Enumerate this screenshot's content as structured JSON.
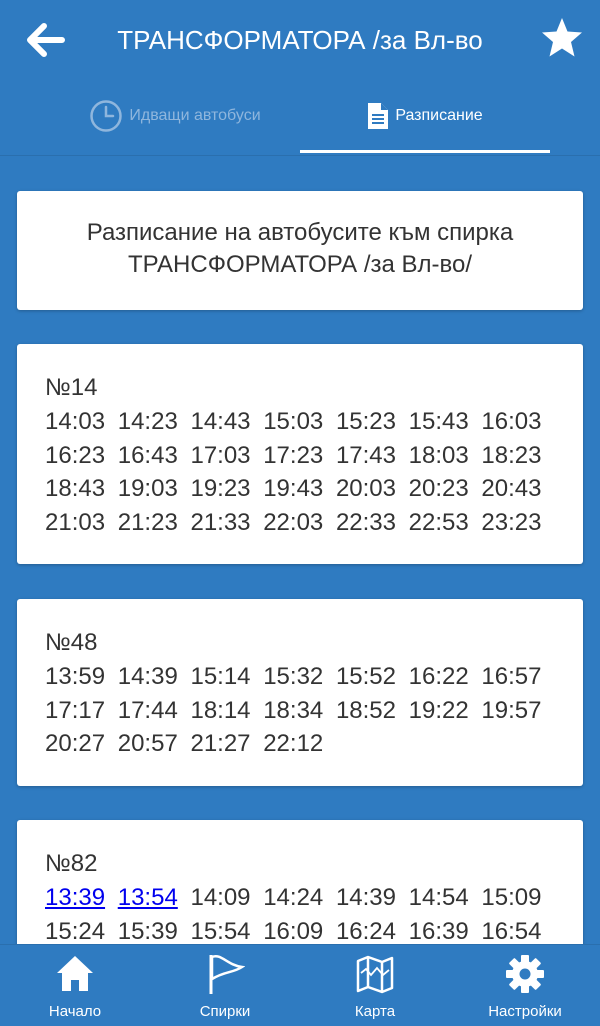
{
  "header": {
    "title": "ТРАНСФОРМАТОРА /за Вл-во",
    "back_icon": "arrow-left-icon",
    "favorite_icon": "star-icon"
  },
  "tabs": [
    {
      "label": "Идващи автобуси",
      "icon": "clock-icon",
      "active": false
    },
    {
      "label": "Разписание",
      "icon": "document-icon",
      "active": true
    }
  ],
  "intro": {
    "text": "Разписание на автобусите към спирка\nТРАНСФОРМАТОРА /за Вл-во/"
  },
  "routes": [
    {
      "number": "№14",
      "times": [
        "14:03",
        "14:23",
        "14:43",
        "15:03",
        "15:23",
        "15:43",
        "16:03",
        "16:23",
        "16:43",
        "17:03",
        "17:23",
        "17:43",
        "18:03",
        "18:23",
        "18:43",
        "19:03",
        "19:23",
        "19:43",
        "20:03",
        "20:23",
        "20:43",
        "21:03",
        "21:23",
        "21:33",
        "22:03",
        "22:33",
        "22:53",
        "23:23"
      ]
    },
    {
      "number": "№48",
      "times": [
        "13:59",
        "14:39",
        "15:14",
        "15:32",
        "15:52",
        "16:22",
        "16:57",
        "17:17",
        "17:44",
        "18:14",
        "18:34",
        "18:52",
        "19:22",
        "19:57",
        "20:27",
        "20:57",
        "21:27",
        "22:12"
      ]
    },
    {
      "number": "№82",
      "times": [
        "13:39",
        "13:54",
        "14:09",
        "14:24",
        "14:39",
        "14:54",
        "15:09",
        "15:24",
        "15:39",
        "15:54",
        "16:09",
        "16:24",
        "16:39",
        "16:54"
      ],
      "linked_times": [
        "13:39",
        "13:54"
      ]
    }
  ],
  "bottom_nav": [
    {
      "label": "Начало",
      "icon": "home-icon"
    },
    {
      "label": "Спирки",
      "icon": "flag-icon"
    },
    {
      "label": "Карта",
      "icon": "map-icon"
    },
    {
      "label": "Настройки",
      "icon": "gear-icon"
    }
  ],
  "colors": {
    "primary": "#2f7bc1",
    "card": "#ffffff",
    "text": "#333333",
    "link": "#0000ee",
    "inactive_tab": "#8fb6dd"
  }
}
